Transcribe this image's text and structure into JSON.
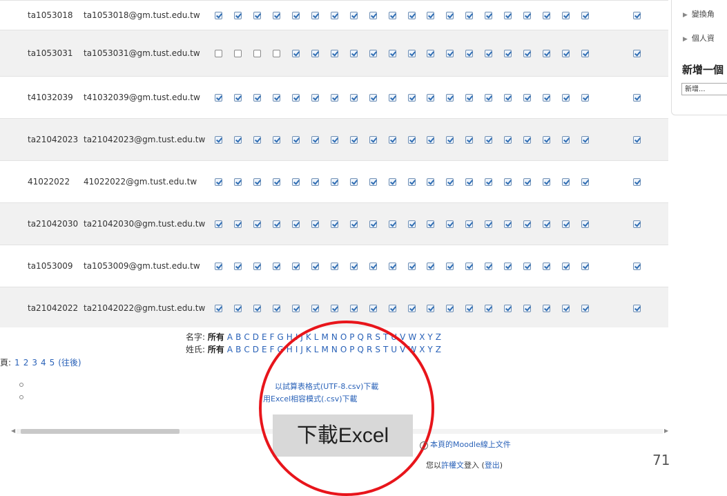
{
  "table": {
    "rows": [
      {
        "id": "ta1053018",
        "email": "ta1053018@gm.tust.edu.tw",
        "checks": [
          1,
          1,
          1,
          1,
          1,
          1,
          1,
          1,
          1,
          1,
          1,
          1,
          1,
          1,
          1,
          1,
          1,
          1,
          1,
          1
        ]
      },
      {
        "id": "ta1053031",
        "email": "ta1053031@gm.tust.edu.tw",
        "checks": [
          0,
          0,
          0,
          0,
          1,
          1,
          1,
          1,
          1,
          1,
          1,
          1,
          1,
          1,
          1,
          1,
          1,
          1,
          1,
          1
        ]
      },
      {
        "id": "t41032039",
        "email": "t41032039@gm.tust.edu.tw",
        "checks": [
          1,
          1,
          1,
          1,
          1,
          1,
          1,
          1,
          1,
          1,
          1,
          1,
          1,
          1,
          1,
          1,
          1,
          1,
          1,
          1
        ]
      },
      {
        "id": "ta21042023",
        "email": "ta21042023@gm.tust.edu.tw",
        "checks": [
          1,
          1,
          1,
          1,
          1,
          1,
          1,
          1,
          1,
          1,
          1,
          1,
          1,
          1,
          1,
          1,
          1,
          1,
          1,
          1
        ]
      },
      {
        "id": "41022022",
        "email": "41022022@gm.tust.edu.tw",
        "checks": [
          1,
          1,
          1,
          1,
          1,
          1,
          1,
          1,
          1,
          1,
          1,
          1,
          1,
          1,
          1,
          1,
          1,
          1,
          1,
          1
        ]
      },
      {
        "id": "ta21042030",
        "email": "ta21042030@gm.tust.edu.tw",
        "checks": [
          1,
          1,
          1,
          1,
          1,
          1,
          1,
          1,
          1,
          1,
          1,
          1,
          1,
          1,
          1,
          1,
          1,
          1,
          1,
          1
        ]
      },
      {
        "id": "ta1053009",
        "email": "ta1053009@gm.tust.edu.tw",
        "checks": [
          1,
          1,
          1,
          1,
          1,
          1,
          1,
          1,
          1,
          1,
          1,
          1,
          1,
          1,
          1,
          1,
          1,
          1,
          1,
          1
        ]
      },
      {
        "id": "ta21042022",
        "email": "ta21042022@gm.tust.edu.tw",
        "checks": [
          1,
          1,
          1,
          1,
          1,
          1,
          1,
          1,
          1,
          1,
          1,
          1,
          1,
          1,
          1,
          1,
          1,
          1,
          1,
          1
        ]
      }
    ]
  },
  "sidebar": {
    "items": [
      {
        "label": "變換角"
      },
      {
        "label": "個人資"
      }
    ],
    "heading": "新增一個",
    "select_value": "新增..."
  },
  "filters": {
    "firstname_label": "名字:",
    "lastname_label": "姓氏:",
    "all_label": "所有",
    "letters": [
      "A",
      "B",
      "C",
      "D",
      "E",
      "F",
      "G",
      "H",
      "I",
      "J",
      "K",
      "L",
      "M",
      "N",
      "O",
      "P",
      "Q",
      "R",
      "S",
      "T",
      "U",
      "V",
      "W",
      "X",
      "Y",
      "Z"
    ]
  },
  "pager": {
    "label": "頁:",
    "pages": [
      "1",
      "2",
      "3",
      "4",
      "5"
    ],
    "next_label": "(往後)"
  },
  "download": {
    "csv_utf8": "以試算表格式(UTF-8.csv)下載",
    "csv_excel": "用Excel相容模式(.csv)下載"
  },
  "annotation": {
    "label": "下載Excel",
    "circle_color": "#e8151b"
  },
  "footer": {
    "doc_link": "本頁的Moodle線上文件",
    "login_prefix": "您以",
    "login_user": "許權文",
    "login_mid": "登入 (",
    "logout": "登出",
    "login_suffix": ")"
  },
  "slide_number": "71",
  "colors": {
    "link": "#2a62b8",
    "accent_red": "#e8151b"
  }
}
